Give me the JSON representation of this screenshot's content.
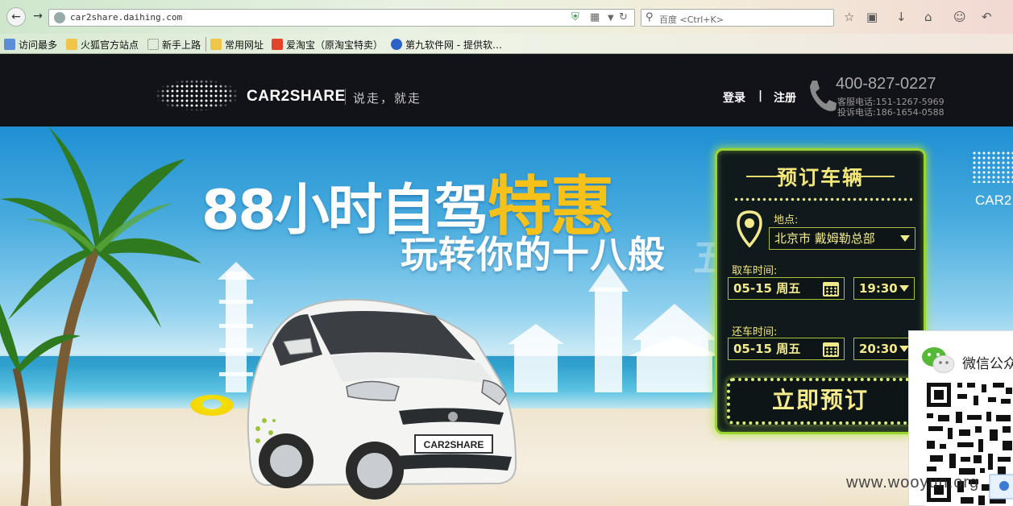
{
  "browser": {
    "url": "car2share.daihing.com",
    "search_placeholder": "百度 <Ctrl+K>",
    "bookmarks": [
      {
        "label": "访问最多",
        "icon": "most-visited-icon"
      },
      {
        "label": "火狐官方站点",
        "icon": "folder-icon"
      },
      {
        "label": "新手上路",
        "icon": "page-icon"
      },
      {
        "label": "常用网址",
        "icon": "folder-icon"
      },
      {
        "label": "爱淘宝（原淘宝特卖）",
        "icon": "taobao-icon"
      },
      {
        "label": "第九软件网 - 提供软…",
        "icon": "d9-icon"
      }
    ]
  },
  "header": {
    "logo_text": "CAR2SHARE",
    "slogan": "说走，就走",
    "login": "登录",
    "separator": "|",
    "register": "注册",
    "hotline": "400-827-0227",
    "service_phone": "客服电话:151-1267-5969",
    "complaint_phone": "投诉电话:186-1654-0588"
  },
  "hero": {
    "headline_prefix": "88小时自驾",
    "headline_highlight": "特惠",
    "subline": "玩转你的十八般",
    "faded_text": "五一",
    "plate_text": "CAR2SHARE",
    "edge_logo_text": "CAR2"
  },
  "booking": {
    "title": "预订车辆",
    "location_label": "地点:",
    "location_value": "北京市 戴姆勒总部",
    "pickup_label": "取车时间:",
    "pickup_date": "05-15 周五",
    "pickup_time": "19:30",
    "return_label": "还车时间:",
    "return_date": "05-15 周五",
    "return_time": "20:30",
    "submit": "立即预订"
  },
  "wechat": {
    "label": "微信公众"
  },
  "watermark": "www.wooyun.org"
}
